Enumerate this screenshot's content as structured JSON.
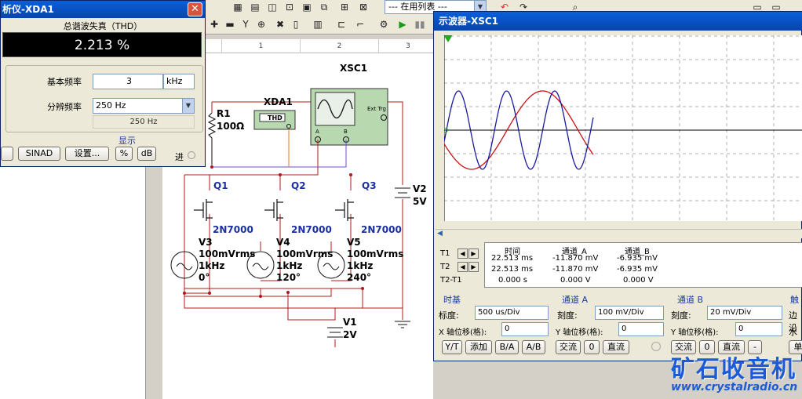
{
  "toolbar": {
    "in_use_list_label": "--- 在用列表 ---",
    "in_use_list_label2": "在用列表"
  },
  "ruler": {
    "marks": [
      "1",
      "2",
      "3"
    ]
  },
  "distortion_analyzer": {
    "title": "析仪-XDA1",
    "header": "总谐波失真（THD）",
    "display_value": "2.213 %",
    "fundamental_label": "基本频率",
    "fundamental_value": "3",
    "fundamental_unit": "kHz",
    "resolution_label": "分辨频率",
    "resolution_value": "250 Hz",
    "resolution_readout": "250 Hz",
    "display_group_label": "显示",
    "sinad_button": "SINAD",
    "settings_button": "设置...",
    "percent_button": "%",
    "db_button": "dB",
    "in_label": "进"
  },
  "schematic": {
    "xsc1": "XSC1",
    "xda1": "XDA1",
    "thd_box": "THD",
    "r1": "R1",
    "r1_value": "100Ω",
    "ext_trg": "Ext Trg",
    "ch_a": "A",
    "ch_b": "B",
    "q1": "Q1",
    "q2": "Q2",
    "q3": "Q3",
    "transistor_model": "2N7000",
    "v2": "V2",
    "v2_value": "5V",
    "v1": "V1",
    "v1_value": "2V",
    "v3": "V3",
    "v4": "V4",
    "v5": "V5",
    "vrms": "100mVrms",
    "freq": "1kHz",
    "phase_v3": "0°",
    "phase_v4": "120°",
    "phase_v5": "240°"
  },
  "oscilloscope": {
    "title": "示波器-XSC1",
    "meas_headers": {
      "time": "时间",
      "ch_a": "通道_A",
      "ch_b": "通道_B"
    },
    "rows": [
      {
        "label": "T1",
        "time": "22.513 ms",
        "ch_a": "-11.870 mV",
        "ch_b": "-6.935 mV"
      },
      {
        "label": "T2",
        "time": "22.513 ms",
        "ch_a": "-11.870 mV",
        "ch_b": "-6.935 mV"
      },
      {
        "label": "T2-T1",
        "time": "0.000 s",
        "ch_a": "0.000 V",
        "ch_b": "0.000 V"
      }
    ],
    "timebase": {
      "title": "时基",
      "scale_label": "标度:",
      "scale_value": "500 us/Div",
      "xpos_label": "X 轴位移(格):",
      "xpos_value": "0",
      "yt": "Y/T",
      "add": "添加",
      "ba": "B/A",
      "ab": "A/B"
    },
    "channel_a": {
      "title": "通道 A",
      "scale_label": "刻度:",
      "scale_value": "100 mV/Div",
      "ypos_label": "Y 轴位移(格):",
      "ypos_value": "0",
      "ac": "交流",
      "zero": "0",
      "dc": "直流"
    },
    "channel_b": {
      "title": "通道 B",
      "scale_label": "刻度:",
      "scale_value": "20 mV/Div",
      "ypos_label": "Y 轴位移(格):",
      "ypos_value": "0",
      "ac": "交流",
      "zero": "0",
      "dc": "直流",
      "minus": "-"
    },
    "trigger": {
      "title": "触",
      "edge": "边沿",
      "level": "水平",
      "single": "单"
    },
    "colors": {
      "channel_a": "#1a1aa0",
      "channel_b": "#cc1010"
    }
  },
  "watermark": {
    "cn": "矿石收音机",
    "en": "www.crystalradio.cn"
  }
}
